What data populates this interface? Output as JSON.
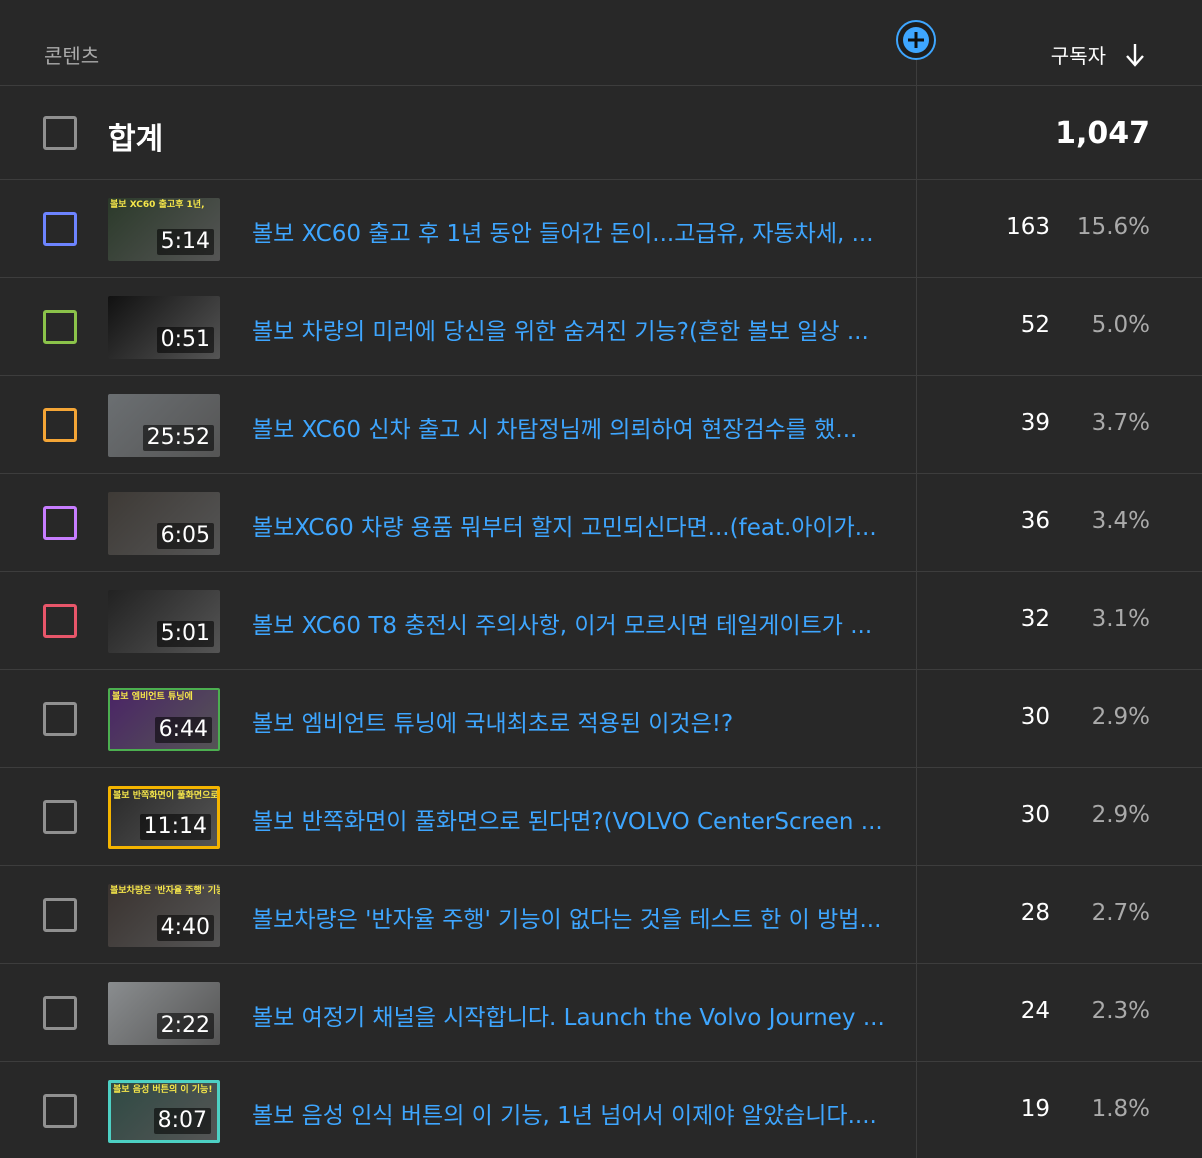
{
  "header": {
    "content_label": "콘텐츠",
    "metric_label": "구독자",
    "sort_icon": "arrow-down-icon",
    "add_column_icon": "plus-circle-icon"
  },
  "total": {
    "label": "합계",
    "value": "1,047"
  },
  "rows": [
    {
      "title": "볼보 XC60 출고 후 1년 동안 들어간 돈이...고급유, 자동차세, ...",
      "duration": "5:14",
      "subscribers": "163",
      "percent": "15.6%",
      "checkbox_color": "#6d84ff",
      "thumb_bg": "#2b3a2a",
      "thumb_caption": "볼보 XC60 출고후 1년,"
    },
    {
      "title": "볼보 차량의 미러에 당신을 위한 숨겨진 기능?(흔한 볼보 일상 ...",
      "duration": "0:51",
      "subscribers": "52",
      "percent": "5.0%",
      "checkbox_color": "#8bc34a",
      "thumb_bg": "#111111",
      "thumb_caption": ""
    },
    {
      "title": "볼보 XC60 신차 출고 시 차탐정님께 의뢰하여 현장검수를 했...",
      "duration": "25:52",
      "subscribers": "39",
      "percent": "3.7%",
      "checkbox_color": "#f4a536",
      "thumb_bg": "#6b6f72",
      "thumb_caption": ""
    },
    {
      "title": "볼보XC60 차량 용품 뭐부터 할지 고민되신다면...(feat.아이가...",
      "duration": "6:05",
      "subscribers": "36",
      "percent": "3.4%",
      "checkbox_color": "#c77dff",
      "thumb_bg": "#3e3a36",
      "thumb_caption": ""
    },
    {
      "title": "볼보 XC60 T8 충전시 주의사항, 이거 모르시면 테일게이트가 ...",
      "duration": "5:01",
      "subscribers": "32",
      "percent": "3.1%",
      "checkbox_color": "#e8566a",
      "thumb_bg": "#222222",
      "thumb_caption": ""
    },
    {
      "title": "볼보 엠비언트 튜닝에 국내최초로 적용된 이것은!?",
      "duration": "6:44",
      "subscribers": "30",
      "percent": "2.9%",
      "checkbox_color": "#909090",
      "thumb_bg": "#4a2466",
      "thumb_caption": "볼보 엠비언트 튜닝에"
    },
    {
      "title": "볼보 반쪽화면이 풀화면으로 된다면?(VOLVO CenterScreen ...",
      "duration": "11:14",
      "subscribers": "30",
      "percent": "2.9%",
      "checkbox_color": "#909090",
      "thumb_bg": "#2a2a2a",
      "thumb_caption": "볼보 반쪽화면이 풀화면으로!"
    },
    {
      "title": "볼보차량은 '반자율 주행' 기능이 없다는 것을 테스트 한 이 방법...",
      "duration": "4:40",
      "subscribers": "28",
      "percent": "2.7%",
      "checkbox_color": "#909090",
      "thumb_bg": "#3a3330",
      "thumb_caption": "볼보차량은 '반자율 주행' 기능이"
    },
    {
      "title": "볼보 여정기 채널을 시작합니다. Launch the Volvo Journey ...",
      "duration": "2:22",
      "subscribers": "24",
      "percent": "2.3%",
      "checkbox_color": "#909090",
      "thumb_bg": "#8a8d8f",
      "thumb_caption": ""
    },
    {
      "title": "볼보 음성 인식 버튼의 이 기능, 1년 넘어서 이제야 알았습니다....",
      "duration": "8:07",
      "subscribers": "19",
      "percent": "1.8%",
      "checkbox_color": "#909090",
      "thumb_bg": "#2f4a44",
      "thumb_caption": "볼보 음성 버튼의 이 기능!"
    }
  ]
}
